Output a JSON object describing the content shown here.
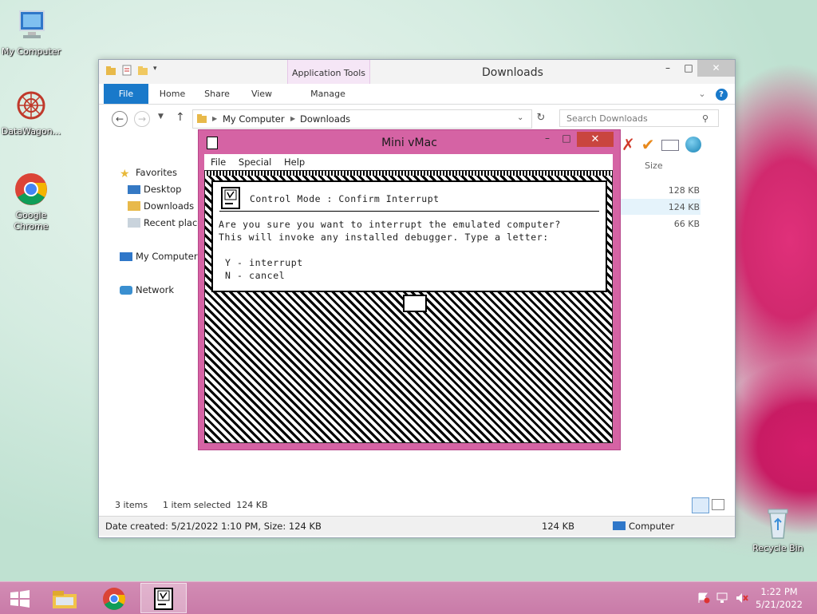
{
  "desktop": {
    "icons": [
      {
        "label": "My Computer"
      },
      {
        "label": "DataWagon..."
      },
      {
        "label": "Google Chrome"
      },
      {
        "label": "Recycle Bin"
      }
    ]
  },
  "explorer": {
    "title": "Downloads",
    "context_tab": "Application Tools",
    "tabs": {
      "file": "File",
      "home": "Home",
      "share": "Share",
      "view": "View",
      "manage": "Manage"
    },
    "window_controls": {
      "minimize": "–",
      "maximize": "□",
      "close": "✕"
    },
    "breadcrumb": {
      "root": "My Computer",
      "current": "Downloads"
    },
    "search_placeholder": "Search Downloads",
    "nav": {
      "favorites": "Favorites",
      "desktop": "Desktop",
      "downloads": "Downloads",
      "recent": "Recent places",
      "computer": "My Computer",
      "network": "Network"
    },
    "columns": {
      "size": "Size"
    },
    "sizes": [
      "128 KB",
      "124 KB",
      "66 KB"
    ],
    "status": {
      "items": "3 items",
      "selected": "1 item selected  124 KB"
    },
    "details": {
      "info": "Date created: 5/21/2022 1:10 PM, Size: 124 KB",
      "size": "124 KB",
      "location": "Computer"
    }
  },
  "vmac": {
    "title": "Mini vMac",
    "menu": {
      "file": "File",
      "special": "Special",
      "help": "Help"
    },
    "dialog": {
      "heading": "Control Mode : Confirm Interrupt",
      "line1": "Are you sure you want to interrupt the emulated computer?",
      "line2": "This will invoke any installed debugger. Type a letter:",
      "opt_y": "Y - interrupt",
      "opt_n": "N - cancel"
    }
  },
  "taskbar": {
    "time": "1:22 PM",
    "date": "5/21/2022"
  },
  "colors": {
    "accent": "#1979ca",
    "vmac_frame": "#d563a4",
    "taskbar": "#c97ba8"
  }
}
